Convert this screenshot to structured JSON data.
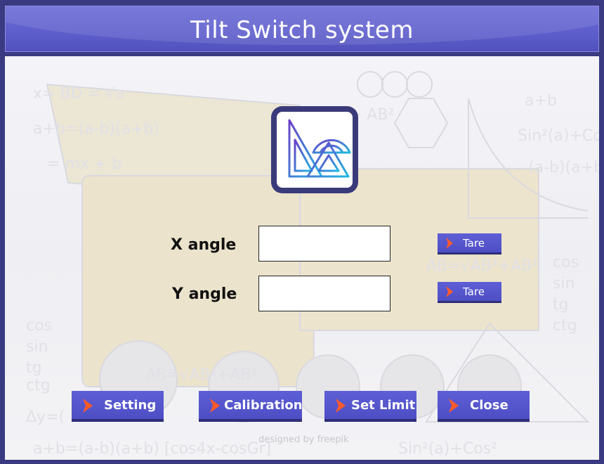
{
  "header": {
    "title": "Tilt Switch system"
  },
  "logo": {
    "icon": "geometry-tools-icon"
  },
  "fields": [
    {
      "label": "X angle",
      "value": "",
      "tare_label": "Tare"
    },
    {
      "label": "Y angle",
      "value": "",
      "tare_label": "Tare"
    }
  ],
  "buttons": {
    "setting": "Setting",
    "calibration": "Calibration",
    "set_limit": "Set Limit",
    "close": "Close"
  },
  "watermark": "designed by freepik",
  "colors": {
    "header": "#5d5dcc",
    "button": "#5454c8",
    "chevron": "#ff5a2a",
    "frame": "#3a3a82"
  }
}
